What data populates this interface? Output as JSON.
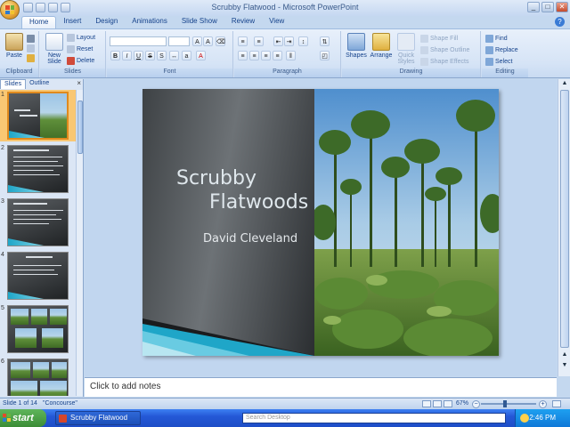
{
  "window": {
    "title": "Scrubby Flatwood - Microsoft PowerPoint",
    "controls": [
      "_",
      "□",
      "✕"
    ]
  },
  "ribbon": {
    "tabs": [
      "Home",
      "Insert",
      "Design",
      "Animations",
      "Slide Show",
      "Review",
      "View"
    ],
    "active_tab": "Home",
    "groups": {
      "clipboard": {
        "label": "Clipboard",
        "paste": "Paste"
      },
      "slides": {
        "label": "Slides",
        "new_slide": "New Slide",
        "layout": "Layout",
        "reset": "Reset",
        "delete": "Delete"
      },
      "font": {
        "label": "Font",
        "font_name": "",
        "font_size": ""
      },
      "paragraph": {
        "label": "Paragraph"
      },
      "drawing": {
        "label": "Drawing",
        "shapes": "Shapes",
        "arrange": "Arrange",
        "quick_styles": "Quick Styles",
        "shape_fill": "Shape Fill",
        "shape_outline": "Shape Outline",
        "shape_effects": "Shape Effects"
      },
      "editing": {
        "label": "Editing",
        "find": "Find",
        "replace": "Replace",
        "select": "Select"
      }
    }
  },
  "left_pane": {
    "tabs": [
      "Slides",
      "Outline"
    ],
    "active_tab": "Slides",
    "close": "×",
    "slide_numbers": [
      "1",
      "2",
      "3",
      "4",
      "5",
      "6"
    ],
    "selected_slide": 1
  },
  "slide": {
    "title_line1": "Scrubby",
    "title_line2": "Flatwoods",
    "subtitle": "David Cleveland"
  },
  "notes": {
    "placeholder": "Click to add notes"
  },
  "status_bar": {
    "slide_info": "Slide 1 of 14",
    "theme": "\"Concourse\"",
    "zoom": "67%"
  },
  "taskbar": {
    "start": "start",
    "task_item": "Scrubby Flatwood",
    "search_placeholder": "Search Desktop",
    "clock": "2:46 PM"
  },
  "colors": {
    "accent_cyan": "#1fa6c8",
    "ribbon_blue": "#d6e4f6",
    "slide_dark": "#3e4245",
    "taskbar_blue": "#2458d6",
    "start_green": "#3b8c35"
  }
}
